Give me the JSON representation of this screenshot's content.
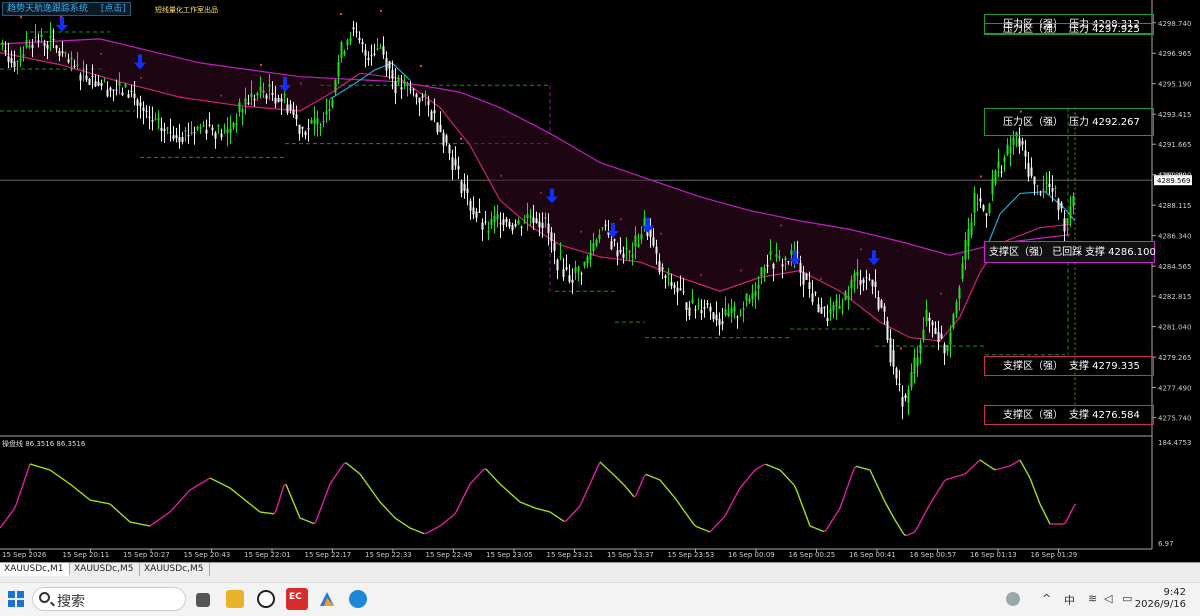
{
  "header": {
    "system_title": "趋势天航逸跟踪系统",
    "click_hint": "[点击]",
    "sub_label": "短线量化工作室出品"
  },
  "oscillator": {
    "label": "操盘线 86.3516 86.3516",
    "max_label": "184.4753",
    "min_label": "6.97"
  },
  "zones": [
    {
      "left": "压力区（强）",
      "right": "压力 4298.312",
      "kind": "res",
      "price": 4298.312
    },
    {
      "left": "压力区（强）",
      "right": "压力 4297.925",
      "kind": "res",
      "price": 4297.925
    },
    {
      "left": "压力区（强）",
      "right": "压力 4292.267",
      "kind": "res",
      "price": 4292.267
    },
    {
      "left": "支撑区（强） 已回踩",
      "right": "支撑 4286.100",
      "kind": "sup-hl",
      "price": 4286.1
    },
    {
      "left": "支撑区（强）",
      "right": "支撑 4279.335",
      "kind": "sup",
      "price": 4279.335
    },
    {
      "left": "支撑区（强）",
      "right": "支撑 4276.584",
      "kind": "sup",
      "price": 4276.584
    }
  ],
  "current_price": "4289.569",
  "current_price_value": 4289.569,
  "bid_price": "4289.890",
  "tabs": [
    {
      "label": "XAUUSDc,M1",
      "active": true
    },
    {
      "label": "XAUUSDc,M5",
      "active": false
    },
    {
      "label": "XAUUSDc,M5",
      "active": false
    }
  ],
  "taskbar": {
    "search_placeholder": "搜索",
    "ime": "中",
    "time": "9:42",
    "date": "2026/9/16"
  },
  "colors": {
    "bull": "#20e020",
    "bear": "#f0f0f0",
    "ma_slow": "#c020c0",
    "ma_fast": "#d0207a",
    "ma_cyan": "#20a8d8",
    "arrow_down": "#1030ff",
    "arrow_up": "#20ff20",
    "osc_green": "#a0e020",
    "osc_magenta": "#e020a0"
  },
  "chart_data": {
    "type": "candlestick",
    "symbol": "XAUUSDc",
    "timeframe": "M1",
    "ylim": [
      4274.9,
      4299.6
    ],
    "y_ticks": [
      4298.74,
      4296.965,
      4295.19,
      4293.415,
      4291.665,
      4289.89,
      4288.115,
      4286.34,
      4284.565,
      4282.815,
      4281.04,
      4279.265,
      4277.49,
      4275.74
    ],
    "y_tick_labels": [
      "4298.740",
      "4296.965",
      "4295.190",
      "4293.415",
      "4291.665",
      "4289.890",
      "4288.115",
      "4286.340",
      "4284.565",
      "4282.815",
      "4281.040",
      "4279.265",
      "4277.490",
      "4275.740"
    ],
    "x_tick_labels": [
      "15 Sep 2026",
      "15 Sep 20:11",
      "15 Sep 20:27",
      "15 Sep 20:43",
      "15 Sep 22:01",
      "15 Sep 22:17",
      "15 Sep 22:33",
      "15 Sep 22:49",
      "15 Sep 23:05",
      "15 Sep 23:21",
      "15 Sep 23:37",
      "15 Sep 23:53",
      "16 Sep 00:09",
      "16 Sep 00:25",
      "16 Sep 00:41",
      "16 Sep 00:57",
      "16 Sep 01:13",
      "16 Sep 01:29"
    ],
    "price_path": [
      [
        0,
        4297.2
      ],
      [
        15,
        4296.5
      ],
      [
        30,
        4297.8
      ],
      [
        50,
        4297.6
      ],
      [
        70,
        4296.2
      ],
      [
        90,
        4295.6
      ],
      [
        110,
        4294.9
      ],
      [
        130,
        4294.7
      ],
      [
        145,
        4293.2
      ],
      [
        165,
        4292.4
      ],
      [
        185,
        4292.3
      ],
      [
        205,
        4292.8
      ],
      [
        225,
        4292.2
      ],
      [
        245,
        4294.2
      ],
      [
        265,
        4294.8
      ],
      [
        285,
        4294.2
      ],
      [
        300,
        4292.6
      ],
      [
        315,
        4292.7
      ],
      [
        330,
        4294.2
      ],
      [
        340,
        4297.0
      ],
      [
        350,
        4298.3
      ],
      [
        365,
        4296.9
      ],
      [
        380,
        4297.4
      ],
      [
        395,
        4295.1
      ],
      [
        410,
        4294.8
      ],
      [
        425,
        4294.1
      ],
      [
        440,
        4292.6
      ],
      [
        455,
        4290.2
      ],
      [
        470,
        4288.1
      ],
      [
        485,
        4286.6
      ],
      [
        500,
        4287.5
      ],
      [
        515,
        4286.9
      ],
      [
        530,
        4287.6
      ],
      [
        545,
        4287.0
      ],
      [
        555,
        4285.0
      ],
      [
        570,
        4283.9
      ],
      [
        585,
        4284.7
      ],
      [
        600,
        4286.9
      ],
      [
        615,
        4285.6
      ],
      [
        630,
        4285.2
      ],
      [
        645,
        4287.1
      ],
      [
        660,
        4284.1
      ],
      [
        675,
        4283.3
      ],
      [
        690,
        4282.1
      ],
      [
        705,
        4282.4
      ],
      [
        720,
        4281.4
      ],
      [
        735,
        4281.8
      ],
      [
        750,
        4282.7
      ],
      [
        765,
        4285.0
      ],
      [
        780,
        4284.8
      ],
      [
        795,
        4285.2
      ],
      [
        810,
        4283.0
      ],
      [
        825,
        4281.6
      ],
      [
        840,
        4282.2
      ],
      [
        855,
        4284.0
      ],
      [
        870,
        4283.8
      ],
      [
        885,
        4281.4
      ],
      [
        895,
        4277.6
      ],
      [
        905,
        4276.6
      ],
      [
        915,
        4279.2
      ],
      [
        925,
        4281.6
      ],
      [
        935,
        4280.9
      ],
      [
        945,
        4279.6
      ],
      [
        955,
        4282.6
      ],
      [
        965,
        4285.6
      ],
      [
        975,
        4288.6
      ],
      [
        985,
        4287.6
      ],
      [
        995,
        4290.1
      ],
      [
        1005,
        4290.9
      ],
      [
        1015,
        4292.2
      ],
      [
        1025,
        4290.8
      ],
      [
        1035,
        4288.9
      ],
      [
        1045,
        4289.4
      ],
      [
        1055,
        4288.6
      ],
      [
        1065,
        4286.9
      ],
      [
        1075,
        4289.6
      ]
    ],
    "ma_slow_path": [
      [
        0,
        4297.5
      ],
      [
        100,
        4297.8
      ],
      [
        200,
        4296.4
      ],
      [
        300,
        4295.6
      ],
      [
        400,
        4295.3
      ],
      [
        460,
        4294.7
      ],
      [
        500,
        4293.8
      ],
      [
        550,
        4292.3
      ],
      [
        600,
        4290.6
      ],
      [
        650,
        4289.6
      ],
      [
        700,
        4288.6
      ],
      [
        750,
        4287.8
      ],
      [
        800,
        4287.2
      ],
      [
        850,
        4286.7
      ],
      [
        900,
        4286.0
      ],
      [
        950,
        4285.2
      ],
      [
        1000,
        4285.9
      ],
      [
        1070,
        4286.4
      ]
    ],
    "ma_fast_path": [
      [
        0,
        4297.0
      ],
      [
        60,
        4296.3
      ],
      [
        120,
        4295.3
      ],
      [
        180,
        4294.4
      ],
      [
        240,
        4293.9
      ],
      [
        300,
        4293.6
      ],
      [
        330,
        4294.6
      ],
      [
        360,
        4295.8
      ],
      [
        400,
        4295.5
      ],
      [
        440,
        4293.8
      ],
      [
        470,
        4291.6
      ],
      [
        500,
        4288.4
      ],
      [
        530,
        4286.9
      ],
      [
        560,
        4285.8
      ],
      [
        600,
        4285.1
      ],
      [
        640,
        4284.8
      ],
      [
        680,
        4283.9
      ],
      [
        720,
        4283.1
      ],
      [
        760,
        4283.9
      ],
      [
        800,
        4284.3
      ],
      [
        840,
        4283.1
      ],
      [
        880,
        4281.3
      ],
      [
        910,
        4280.4
      ],
      [
        940,
        4280.2
      ],
      [
        960,
        4281.6
      ],
      [
        980,
        4284.2
      ],
      [
        1000,
        4285.9
      ],
      [
        1040,
        4286.8
      ],
      [
        1070,
        4287.0
      ]
    ],
    "ma_cyan_path": [
      [
        330,
        4294.3
      ],
      [
        355,
        4295.2
      ],
      [
        375,
        4296.0
      ],
      [
        392,
        4296.4
      ],
      [
        410,
        4295.4
      ]
    ],
    "ma_cyan_path_2": [
      [
        985,
        4285.4
      ],
      [
        1000,
        4287.6
      ],
      [
        1020,
        4288.8
      ],
      [
        1045,
        4288.9
      ],
      [
        1065,
        4287.9
      ],
      [
        1075,
        4287.2
      ]
    ],
    "down_arrows": [
      [
        62,
        4298.5
      ],
      [
        140,
        4296.3
      ],
      [
        285,
        4295.0
      ],
      [
        552,
        4288.5
      ],
      [
        613,
        4286.5
      ],
      [
        648,
        4286.8
      ],
      [
        795,
        4284.9
      ],
      [
        874,
        4284.9
      ]
    ],
    "up_arrows": [
      [
        1072,
        4285.6
      ]
    ],
    "osc_path": [
      [
        0,
        16
      ],
      [
        15,
        36
      ],
      [
        30,
        80
      ],
      [
        50,
        74
      ],
      [
        70,
        60
      ],
      [
        90,
        44
      ],
      [
        110,
        40
      ],
      [
        130,
        22
      ],
      [
        150,
        18
      ],
      [
        170,
        32
      ],
      [
        190,
        54
      ],
      [
        210,
        66
      ],
      [
        230,
        56
      ],
      [
        250,
        40
      ],
      [
        260,
        32
      ],
      [
        275,
        30
      ],
      [
        285,
        62
      ],
      [
        300,
        26
      ],
      [
        315,
        20
      ],
      [
        330,
        60
      ],
      [
        345,
        82
      ],
      [
        360,
        70
      ],
      [
        380,
        42
      ],
      [
        395,
        26
      ],
      [
        410,
        16
      ],
      [
        425,
        10
      ],
      [
        440,
        18
      ],
      [
        455,
        30
      ],
      [
        470,
        60
      ],
      [
        485,
        76
      ],
      [
        500,
        60
      ],
      [
        520,
        42
      ],
      [
        535,
        36
      ],
      [
        550,
        32
      ],
      [
        565,
        22
      ],
      [
        580,
        38
      ],
      [
        600,
        82
      ],
      [
        615,
        68
      ],
      [
        625,
        58
      ],
      [
        635,
        46
      ],
      [
        645,
        70
      ],
      [
        660,
        64
      ],
      [
        675,
        46
      ],
      [
        695,
        18
      ],
      [
        710,
        12
      ],
      [
        725,
        28
      ],
      [
        740,
        56
      ],
      [
        755,
        74
      ],
      [
        765,
        80
      ],
      [
        780,
        74
      ],
      [
        795,
        58
      ],
      [
        810,
        18
      ],
      [
        825,
        12
      ],
      [
        840,
        36
      ],
      [
        855,
        78
      ],
      [
        870,
        74
      ],
      [
        885,
        42
      ],
      [
        895,
        24
      ],
      [
        905,
        8
      ],
      [
        915,
        12
      ],
      [
        930,
        40
      ],
      [
        945,
        64
      ],
      [
        965,
        70
      ],
      [
        980,
        84
      ],
      [
        995,
        74
      ],
      [
        1010,
        78
      ],
      [
        1020,
        84
      ],
      [
        1030,
        66
      ],
      [
        1040,
        40
      ],
      [
        1050,
        20
      ],
      [
        1065,
        20
      ],
      [
        1075,
        40
      ]
    ]
  }
}
